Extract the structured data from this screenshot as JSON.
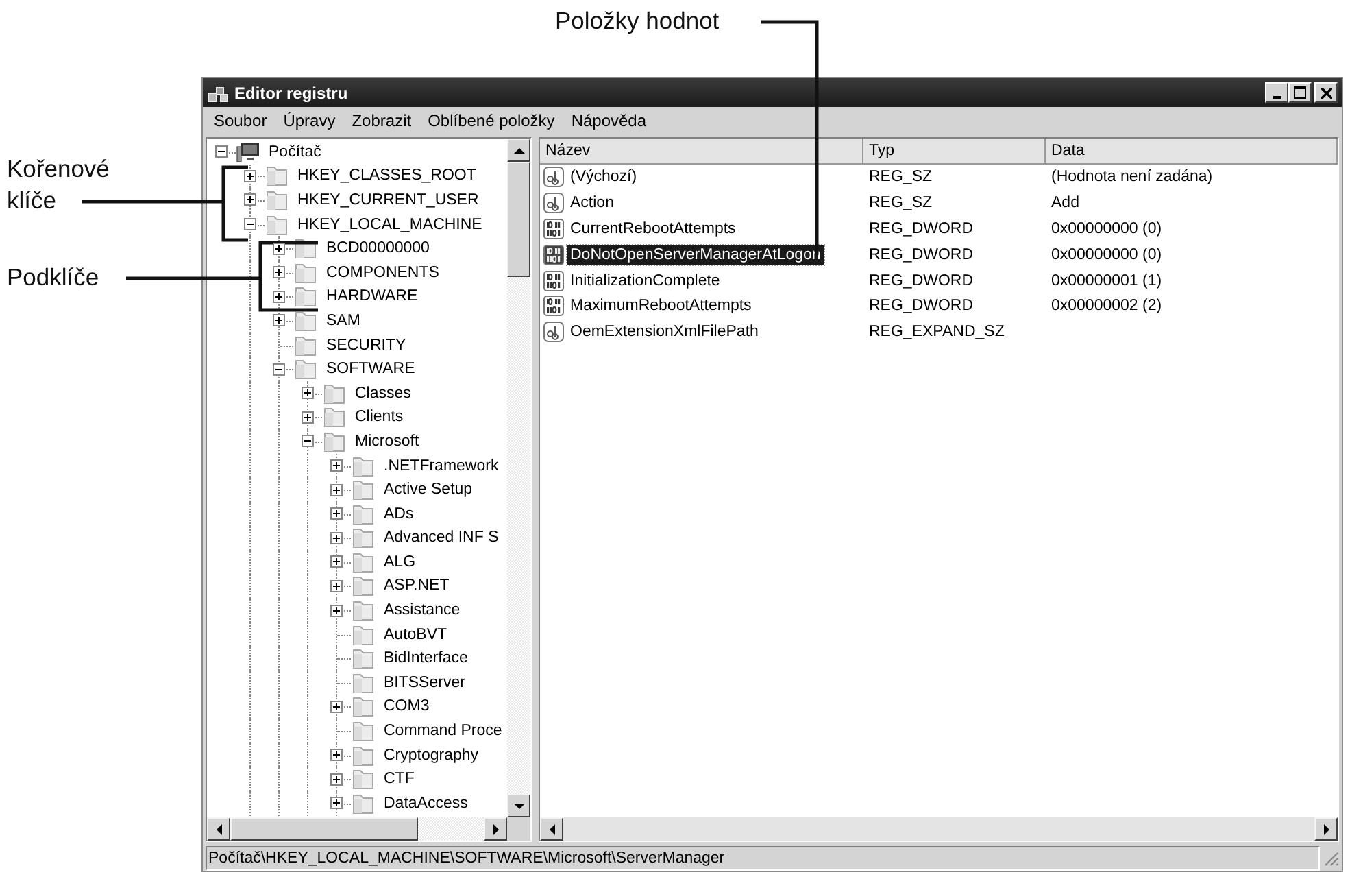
{
  "callouts": [
    {
      "label": "Položky hodnot"
    },
    {
      "label": "Kořenové klíče"
    },
    {
      "label": "Podklíče"
    }
  ],
  "window": {
    "title": "Editor registru"
  },
  "menu": [
    "Soubor",
    "Úpravy",
    "Zobrazit",
    "Oblíbené položky",
    "Nápověda"
  ],
  "tree": {
    "label": "Počítač",
    "expanded": true,
    "children": [
      {
        "label": "HKEY_CLASSES_ROOT",
        "expanded": false
      },
      {
        "label": "HKEY_CURRENT_USER",
        "expanded": false
      },
      {
        "label": "HKEY_LOCAL_MACHINE",
        "expanded": true,
        "children": [
          {
            "label": "BCD00000000",
            "expanded": false
          },
          {
            "label": "COMPONENTS",
            "expanded": false
          },
          {
            "label": "HARDWARE",
            "expanded": false
          },
          {
            "label": "SAM",
            "expanded": false
          },
          {
            "label": "SECURITY"
          },
          {
            "label": "SOFTWARE",
            "expanded": true,
            "children": [
              {
                "label": "Classes",
                "expanded": false
              },
              {
                "label": "Clients",
                "expanded": false
              },
              {
                "label": "Microsoft",
                "expanded": true,
                "children": [
                  {
                    "label": ".NETFramework",
                    "expanded": false
                  },
                  {
                    "label": "Active Setup",
                    "expanded": false
                  },
                  {
                    "label": "ADs",
                    "expanded": false
                  },
                  {
                    "label": "Advanced INF S",
                    "expanded": false
                  },
                  {
                    "label": "ALG",
                    "expanded": false
                  },
                  {
                    "label": "ASP.NET",
                    "expanded": false
                  },
                  {
                    "label": "Assistance",
                    "expanded": false
                  },
                  {
                    "label": "AutoBVT"
                  },
                  {
                    "label": "BidInterface"
                  },
                  {
                    "label": "BITSServer"
                  },
                  {
                    "label": "COM3",
                    "expanded": false
                  },
                  {
                    "label": "Command Proce"
                  },
                  {
                    "label": "Cryptography",
                    "expanded": false
                  },
                  {
                    "label": "CTF",
                    "expanded": false
                  },
                  {
                    "label": "DataAccess",
                    "expanded": false
                  }
                ]
              }
            ]
          }
        ]
      }
    ]
  },
  "values": {
    "columns": [
      "Název",
      "Typ",
      "Data"
    ],
    "rows": [
      {
        "kind": "string",
        "name": "(Výchozí)",
        "type": "REG_SZ",
        "data": "(Hodnota není zadána)",
        "selected": false
      },
      {
        "kind": "string",
        "name": "Action",
        "type": "REG_SZ",
        "data": "Add",
        "selected": false
      },
      {
        "kind": "binary",
        "name": "CurrentRebootAttempts",
        "type": "REG_DWORD",
        "data": "0x00000000 (0)",
        "selected": false
      },
      {
        "kind": "binary",
        "name": "DoNotOpenServerManagerAtLogon",
        "type": "REG_DWORD",
        "data": "0x00000000 (0)",
        "selected": true
      },
      {
        "kind": "binary",
        "name": "InitializationComplete",
        "type": "REG_DWORD",
        "data": "0x00000001 (1)",
        "selected": false
      },
      {
        "kind": "binary",
        "name": "MaximumRebootAttempts",
        "type": "REG_DWORD",
        "data": "0x00000002 (2)",
        "selected": false
      },
      {
        "kind": "string",
        "name": "OemExtensionXmlFilePath",
        "type": "REG_EXPAND_SZ",
        "selected": false
      }
    ]
  },
  "status_bar": "Počítač\\HKEY_LOCAL_MACHINE\\SOFTWARE\\Microsoft\\ServerManager"
}
